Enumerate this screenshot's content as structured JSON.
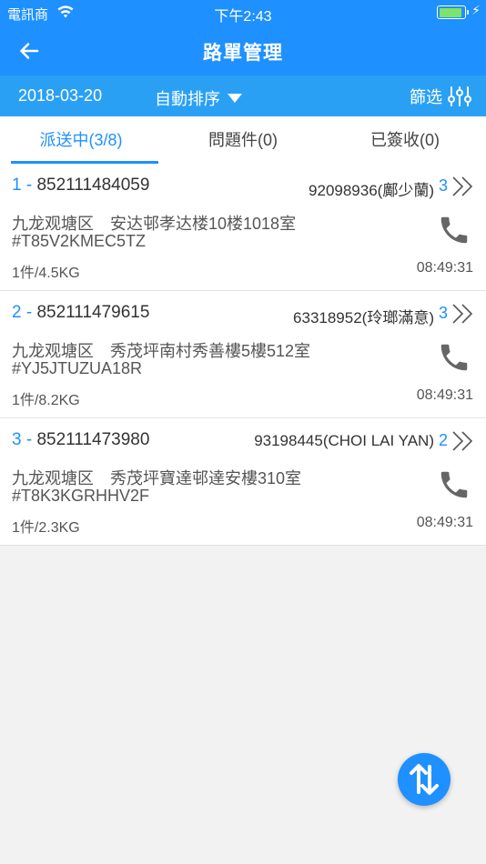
{
  "status_bar": {
    "carrier": "電訊商",
    "time": "下午2:43",
    "battery_level": 0.85
  },
  "nav": {
    "title": "路單管理",
    "back_icon": "arrow-left-icon"
  },
  "toolbar": {
    "date": "2018-03-20",
    "sort_label": "自動排序",
    "filter_label": "篩选"
  },
  "tabs": [
    {
      "label": "派送中(3/8)",
      "active": true
    },
    {
      "label": "問題件(0)",
      "active": false
    },
    {
      "label": "已簽收(0)",
      "active": false
    }
  ],
  "items": [
    {
      "index": "1 - ",
      "tracking": "852111484059",
      "contact": "92098936(鄺少蘭)",
      "count": "3",
      "address": "九龙观塘区　安达邨孝达楼10楼1018室",
      "code": "#T85V2KMEC5TZ",
      "weight": "1件/4.5KG",
      "time": "08:49:31"
    },
    {
      "index": "2 - ",
      "tracking": "852111479615",
      "contact": "63318952(玲瑯滿意)",
      "count": "3",
      "address": "九龙观塘区　秀茂坪南村秀善樓5樓512室",
      "code": "#YJ5JTUZUA18R",
      "weight": "1件/8.2KG",
      "time": "08:49:31"
    },
    {
      "index": "3 - ",
      "tracking": "852111473980",
      "contact": "93198445(CHOI LAI YAN)",
      "count": "2",
      "address": "九龙观塘区　秀茂坪寶達邨達安樓310室",
      "code": "#T8K3KGRHHV2F",
      "weight": "1件/2.3KG",
      "time": "08:49:31"
    }
  ],
  "colors": {
    "primary": "#1e90ff",
    "toolbar": "#2aa0f5"
  }
}
